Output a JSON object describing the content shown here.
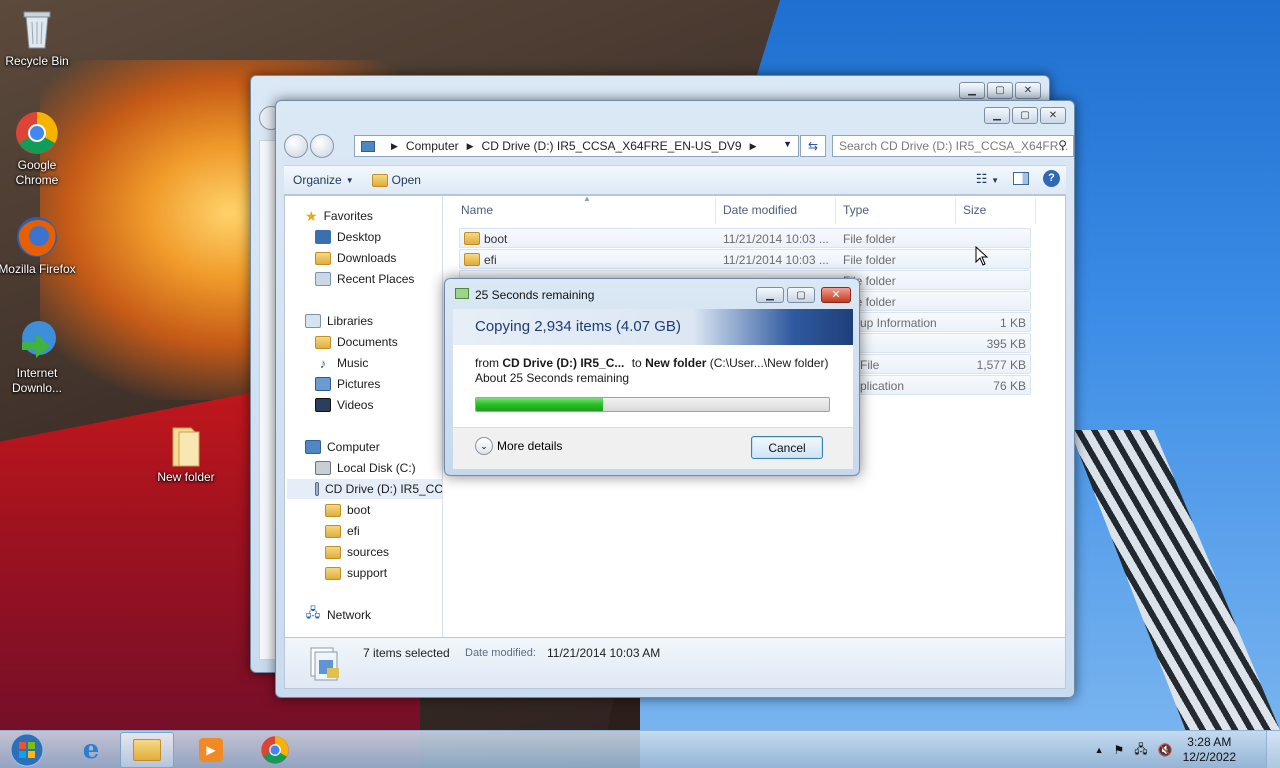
{
  "desktop": {
    "icons": [
      {
        "label": "Recycle Bin"
      },
      {
        "label": "Google Chrome"
      },
      {
        "label": "Mozilla Firefox"
      },
      {
        "label": "Internet Downlo..."
      },
      {
        "label": "New folder"
      }
    ]
  },
  "explorer": {
    "address": {
      "crumbs": [
        "Computer",
        "CD Drive (D:) IR5_CCSA_X64FRE_EN-US_DV9"
      ]
    },
    "search_placeholder": "Search CD Drive (D:) IR5_CCSA_X64FR...",
    "toolbar": {
      "organize": "Organize",
      "open": "Open"
    },
    "nav": {
      "favorites": "Favorites",
      "desktop": "Desktop",
      "downloads": "Downloads",
      "recent": "Recent Places",
      "libraries": "Libraries",
      "documents": "Documents",
      "music": "Music",
      "pictures": "Pictures",
      "videos": "Videos",
      "computer": "Computer",
      "local_disk": "Local Disk (C:)",
      "cd_drive": "CD Drive (D:) IR5_CC",
      "boot": "boot",
      "efi": "efi",
      "sources": "sources",
      "support": "support",
      "network": "Network"
    },
    "columns": {
      "name": "Name",
      "date": "Date modified",
      "type": "Type",
      "size": "Size"
    },
    "rows": [
      {
        "name": "boot",
        "date": "11/21/2014 10:03 ...",
        "type": "File folder",
        "size": ""
      },
      {
        "name": "efi",
        "date": "11/21/2014 10:03 ...",
        "type": "File folder",
        "size": ""
      },
      {
        "name": "",
        "date": "",
        "type": "File folder",
        "size": ""
      },
      {
        "name": "",
        "date": "",
        "type": "File folder",
        "size": ""
      },
      {
        "name": "",
        "date": "",
        "type": "up Information",
        "size": "1 KB"
      },
      {
        "name": "",
        "date": "",
        "type": "",
        "size": "395 KB"
      },
      {
        "name": "",
        "date": "",
        "type": "File",
        "size": "1,577 KB"
      },
      {
        "name": "",
        "date": "",
        "type": "plication",
        "size": "76 KB"
      }
    ],
    "details": {
      "selected": "7 items selected",
      "date_label": "Date modified:",
      "date_value": "11/21/2014 10:03 AM"
    }
  },
  "copy_dialog": {
    "title": "25 Seconds remaining",
    "heading": "Copying 2,934 items (4.07 GB)",
    "from_label": "from",
    "from_value": "CD Drive (D:) IR5_C...",
    "to_label": "to",
    "to_value": "New folder",
    "to_path": "(C:\\User...\\New folder)",
    "remaining": "About 25 Seconds remaining",
    "progress_percent": 36,
    "more_details": "More details",
    "cancel": "Cancel"
  },
  "taskbar": {
    "time": "3:28 AM",
    "date": "12/2/2022"
  },
  "colors": {
    "progress_fill": "#2fc22a",
    "banner_blue": "#1f3f7a"
  }
}
